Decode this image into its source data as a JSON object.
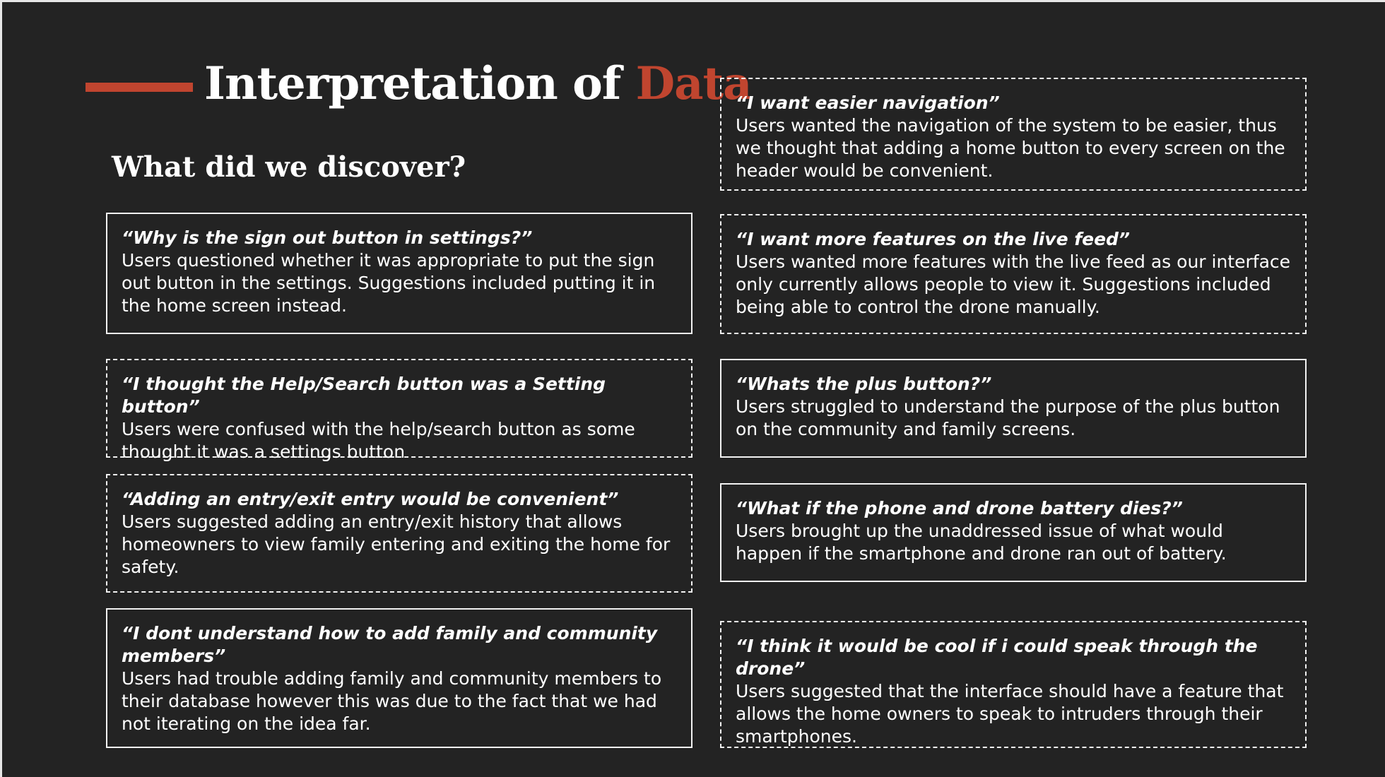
{
  "header": {
    "title_main": "Interpretation of ",
    "title_accent": "Data",
    "subtitle": "What did we discover?"
  },
  "colors": {
    "background": "#232323",
    "accent": "#c0452f",
    "text": "#ffffff"
  },
  "findings": [
    {
      "quote": "“Why is the sign out button in settings?”",
      "body": "Users questioned whether it was appropriate to put the sign out button in the settings. Suggestions included putting it in the home screen instead."
    },
    {
      "quote": "“I thought the Help/Search button was a Setting button”",
      "body": "Users were confused with the help/search button as some thought it was a settings button"
    },
    {
      "quote": "“Adding an entry/exit entry would be convenient”",
      "body": "Users suggested adding an entry/exit history that allows homeowners to view family entering and exiting the home for safety."
    },
    {
      "quote": "“I dont understand how to add family and community members”",
      "body": "Users had trouble adding family and community members to their database however this was due to the fact that we had not iterating on the idea far."
    },
    {
      "quote": "“I want easier navigation”",
      "body": "Users wanted the navigation of the system to be easier, thus we thought that adding a home button to every screen on the header would be convenient."
    },
    {
      "quote": "“I want more features on the live feed”",
      "body": "Users wanted more features with the live feed as our interface only currently allows people to view it. Suggestions included being able to control the drone manually."
    },
    {
      "quote": "“Whats the plus button?”",
      "body": "Users struggled to understand the purpose of the plus button on the community and family screens."
    },
    {
      "quote": "“What if the phone and drone battery dies?”",
      "body": "Users brought up the unaddressed issue of what would happen if the smartphone and drone ran out of battery."
    },
    {
      "quote": "“I think it would be cool if i could speak through the drone”",
      "body": "Users suggested that the interface should have a feature that allows the home owners to speak to intruders through their smartphones."
    }
  ]
}
